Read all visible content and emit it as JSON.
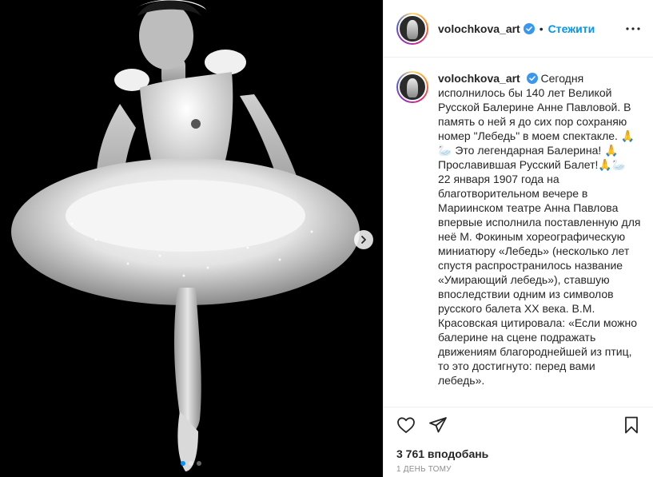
{
  "post": {
    "username": "volochkova_art",
    "separator": "•",
    "follow_label": "Стежити",
    "caption": "Сегодня исполнилось бы 140 лет Великой Русской Балерине Анне Павловой. В память о ней я до сих пор сохраняю номер \"Лебедь\" в моем спектакле. 🙏🦢 Это легендарная Балерина! 🙏 Прославившая Русский Балет!🙏🦢 22 января 1907 года на благотворительном вечере в Мариинском театре Анна Павлова впервые исполнила поставленную для неё М. Фокиным хореографическую миниатюру «Лебедь» (несколько лет спустя распространилось название «Умирающий лебедь»), ставшую впоследствии одним из символов русского балета XX века. В.М. Красовская цитировала: «Если можно балерине на сцене подражать движениям благороднейшей из птиц, то это достигнуто: перед вами лебедь».",
    "likes": "3 761 вподобань",
    "time": "1 ДЕНЬ ТОМУ"
  },
  "carousel": {
    "slides": 3,
    "active_slide": 1
  },
  "icons": {
    "verified": "verified-badge-icon",
    "more": "more-options-icon",
    "like": "heart-icon",
    "share": "paper-plane-icon",
    "save": "bookmark-icon",
    "next": "chevron-right-icon"
  },
  "colors": {
    "accent": "#0095f6",
    "text": "#262626",
    "muted": "#8e8e8e",
    "border": "#efefef"
  }
}
